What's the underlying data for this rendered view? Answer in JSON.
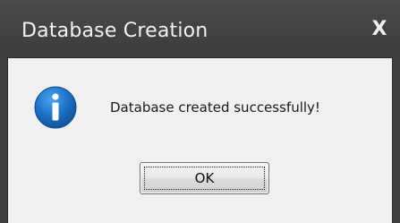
{
  "dialog": {
    "title": "Database Creation",
    "close_label": "X",
    "icon": "info-icon",
    "message": "Database created successfully!",
    "ok_label": "OK"
  },
  "colors": {
    "titlebar": "#414141",
    "title_text": "#f2f2f2",
    "content_background": "#f0f0f0",
    "info_icon_blue": "#1c6fc4"
  }
}
